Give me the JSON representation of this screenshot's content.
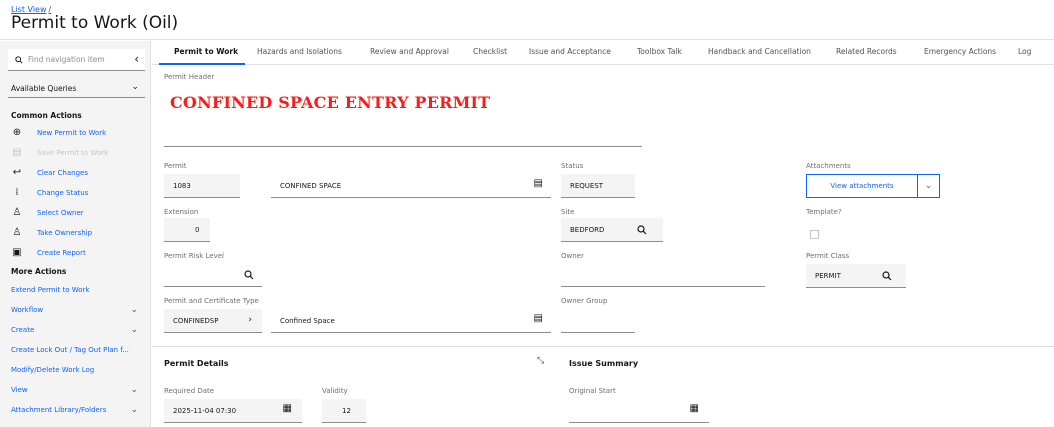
{
  "header": {
    "breadcrumb": "List View",
    "breadcrumb_sep": "/",
    "title": "Permit to Work (Oil)"
  },
  "sidebar": {
    "search_placeholder": "Find navigation item",
    "collapse_icon": "chevron-left-icon",
    "queries_label": "Available Queries",
    "common_actions_heading": "Common Actions",
    "common_actions": [
      {
        "icon": "plus-circle-icon",
        "label": "New Permit to Work",
        "enabled": true
      },
      {
        "icon": "save-icon",
        "label": "Save Permit to Work",
        "enabled": false
      },
      {
        "icon": "undo-icon",
        "label": "Clear Changes",
        "enabled": true
      },
      {
        "icon": "status-icon",
        "label": "Change Status",
        "enabled": true
      },
      {
        "icon": "user-icon",
        "label": "Select Owner",
        "enabled": true
      },
      {
        "icon": "user-take-icon",
        "label": "Take Ownership",
        "enabled": true
      },
      {
        "icon": "report-icon",
        "label": "Create Report",
        "enabled": true
      }
    ],
    "more_actions_heading": "More Actions",
    "more_actions": [
      {
        "label": "Extend Permit to Work",
        "expandable": false
      },
      {
        "label": "Workflow",
        "expandable": true
      },
      {
        "label": "Create",
        "expandable": true
      },
      {
        "label": "Create Lock Out / Tag Out Plan f...",
        "expandable": false
      },
      {
        "label": "Modify/Delete Work Log",
        "expandable": false
      },
      {
        "label": "View",
        "expandable": true
      },
      {
        "label": "Attachment Library/Folders",
        "expandable": true
      }
    ]
  },
  "tabs": [
    {
      "label": "Permit to Work",
      "active": true
    },
    {
      "label": "Hazards and Isolations",
      "active": false
    },
    {
      "label": "Review and Approval",
      "active": false
    },
    {
      "label": "Checklist",
      "active": false
    },
    {
      "label": "Issue and Acceptance",
      "active": false
    },
    {
      "label": "Toolbox Talk",
      "active": false
    },
    {
      "label": "Handback and Cancellation",
      "active": false
    },
    {
      "label": "Related Records",
      "active": false
    },
    {
      "label": "Emergency Actions",
      "active": false
    },
    {
      "label": "Log",
      "active": false
    }
  ],
  "form": {
    "permit_header_label": "Permit Header",
    "permit_header_value": "CONFINED SPACE ENTRY PERMIT",
    "permit_label": "Permit",
    "permit_value": "1083",
    "permit_desc": "CONFINED SPACE",
    "status_label": "Status",
    "status_value": "REQUEST",
    "attachments_label": "Attachments",
    "view_attachments": "View attachments",
    "extension_label": "Extension",
    "extension_value": "0",
    "site_label": "Site",
    "site_value": "BEDFORD",
    "template_label": "Template?",
    "risk_label": "Permit Risk Level",
    "risk_value": "",
    "owner_label": "Owner",
    "owner_value": "",
    "class_label": "Permit Class",
    "class_value": "PERMIT",
    "type_label": "Permit and Certificate Type",
    "type_value": "CONFINEDSP",
    "type_desc": "Confined Space",
    "owner_group_label": "Owner Group",
    "owner_group_value": "",
    "details_title": "Permit Details",
    "issue_summary_title": "Issue Summary",
    "required_date_label": "Required Date",
    "required_date_value": "2025-11-04 07:30",
    "validity_label": "Validity",
    "validity_value": "12",
    "original_start_label": "Original Start",
    "original_start_value": ""
  },
  "colors": {
    "accent": "#0f62fe",
    "heading_red": "#ff1a1a"
  }
}
